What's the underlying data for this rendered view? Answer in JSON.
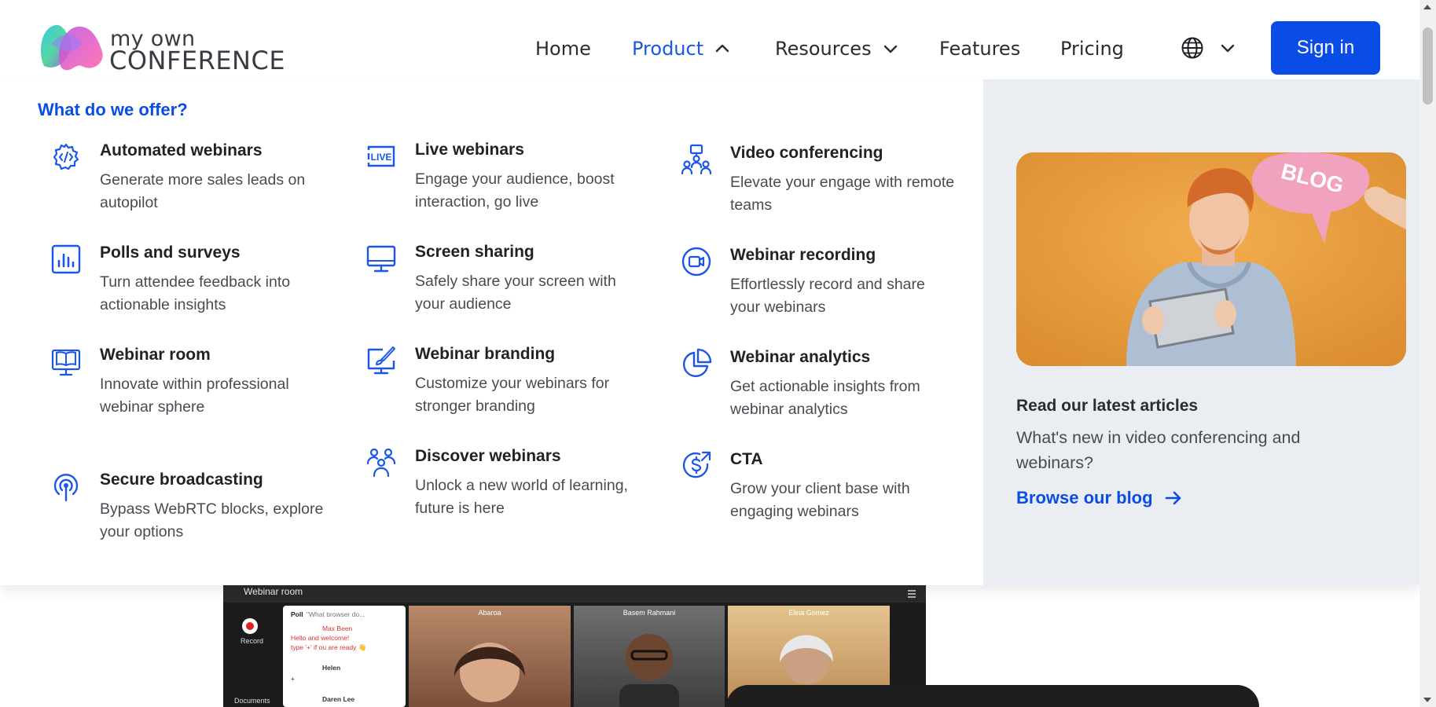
{
  "brand": {
    "line1": "my own",
    "line2": "CONFERENCE"
  },
  "nav": {
    "home": "Home",
    "product": "Product",
    "resources": "Resources",
    "features": "Features",
    "pricing": "Pricing",
    "signin": "Sign in"
  },
  "menu": {
    "heading": "What do we offer?",
    "items": [
      {
        "title": "Automated webinars",
        "desc": "Generate more sales leads on autopilot",
        "icon": "gear-code-icon"
      },
      {
        "title": "Live webinars",
        "desc": "Engage your audience, boost interaction, go live",
        "icon": "live-icon"
      },
      {
        "title": "Video conferencing",
        "desc": "Elevate your engage with remote teams",
        "icon": "people-presenter-icon"
      },
      {
        "title": "Polls and surveys",
        "desc": "Turn attendee feedback into actionable insights",
        "icon": "bar-chart-icon"
      },
      {
        "title": "Screen sharing",
        "desc": "Safely share your screen with your audience",
        "icon": "monitor-icon"
      },
      {
        "title": "Webinar recording",
        "desc": "Effortlessly record and share your webinars",
        "icon": "record-camera-icon"
      },
      {
        "title": "Webinar room",
        "desc": "Innovate within professional webinar sphere",
        "icon": "book-monitor-icon"
      },
      {
        "title": "Webinar branding",
        "desc": "Customize your webinars for stronger branding",
        "icon": "brush-monitor-icon"
      },
      {
        "title": "Webinar analytics",
        "desc": "Get actionable insights from webinar analytics",
        "icon": "pie-chart-icon"
      },
      {
        "title": "Secure broadcasting",
        "desc": "Bypass WebRTC blocks, explore your options",
        "icon": "broadcast-icon"
      },
      {
        "title": "Discover webinars",
        "desc": "Unlock a new world of learning, future is here",
        "icon": "group-icon"
      },
      {
        "title": "CTA",
        "desc": "Grow your client base with engaging webinars",
        "icon": "dollar-arrow-icon"
      }
    ]
  },
  "blog": {
    "image_badge": "BLOG",
    "heading": "Read our latest articles",
    "subtitle": "What's new in video conferencing and webinars?",
    "link": "Browse our blog"
  },
  "preview": {
    "title": "Webinar room",
    "record_label": "Record",
    "documents_label": "Documents",
    "poll_label": "Poll",
    "poll_question": "\"What browser do...",
    "chat": [
      {
        "name": "Max Been",
        "text": "Hello and welcome!"
      },
      {
        "name": "",
        "text": "type '+' if ou are ready 👋"
      },
      {
        "name": "Helen",
        "text": "+"
      },
      {
        "name": "Daren Lee",
        "text": ""
      }
    ],
    "participants": [
      "Abaroa",
      "Basem Rahmani",
      "Elina Gomez"
    ]
  },
  "colors": {
    "accent": "#0a4de6",
    "panel_bg": "#eaedf2",
    "text": "#222222"
  }
}
